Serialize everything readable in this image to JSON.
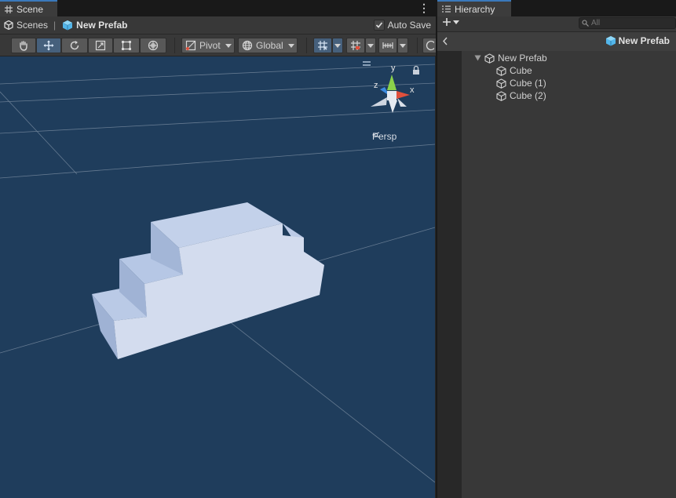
{
  "scene": {
    "tab_label": "Scene",
    "breadcrumb": {
      "root": "Scenes",
      "separator": "|",
      "current": "New Prefab"
    },
    "auto_save": {
      "label": "Auto Save",
      "checked": true
    },
    "toolbar": {
      "pivot_label": "Pivot",
      "global_label": "Global"
    },
    "view_mode": "Persp",
    "gizmo_axes": {
      "x": "x",
      "y": "y",
      "z": "z"
    }
  },
  "hierarchy": {
    "tab_label": "Hierarchy",
    "search_placeholder": "All",
    "prefab_title": "New Prefab",
    "root": "New Prefab",
    "children": [
      "Cube",
      "Cube (1)",
      "Cube (2)"
    ]
  },
  "colors": {
    "accent": "#3a79bb",
    "viewport_bg": "#1f3d5c",
    "active_tool": "#46607c",
    "prefab_blue": "#53b6ea",
    "gizmo_x": "#e0503c",
    "gizmo_y": "#8bd24a",
    "gizmo_z": "#3c8be0"
  }
}
